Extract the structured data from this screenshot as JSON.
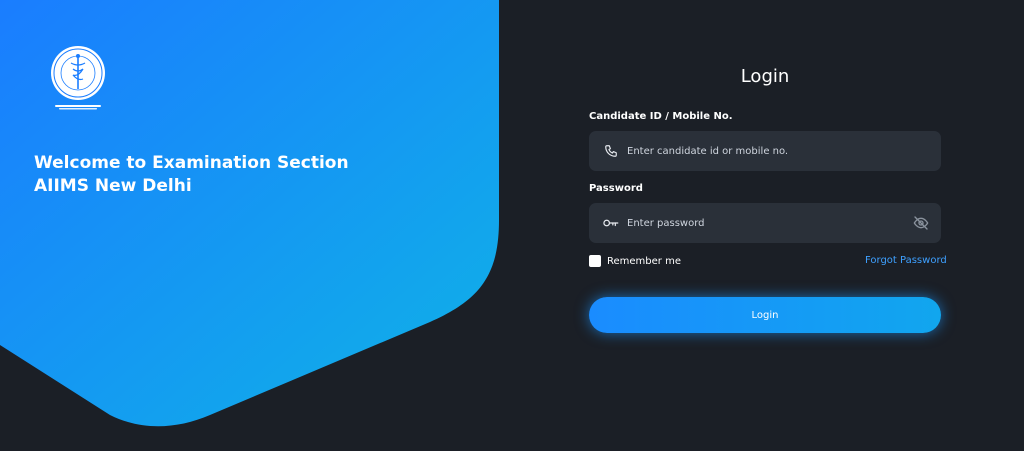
{
  "hero": {
    "welcome_line1": "Welcome to Examination Section",
    "welcome_line2": "AIIMS New Delhi",
    "logo_icon": "aiims-emblem-icon"
  },
  "login": {
    "title": "Login",
    "candidate_label": "Candidate ID / Mobile No.",
    "candidate_placeholder": "Enter candidate id or mobile no.",
    "candidate_icon": "phone-icon",
    "password_label": "Password",
    "password_placeholder": "Enter password",
    "password_icon": "key-icon",
    "toggle_icon": "eye-off-icon",
    "remember_label": "Remember me",
    "forgot_label": "Forgot Password",
    "submit_label": "Login"
  },
  "colors": {
    "background": "#1b1f26",
    "hero_gradient_start": "#1a7dff",
    "hero_gradient_end": "#0fb3e6",
    "field_bg": "#2a3039",
    "link": "#3ea0ff"
  }
}
